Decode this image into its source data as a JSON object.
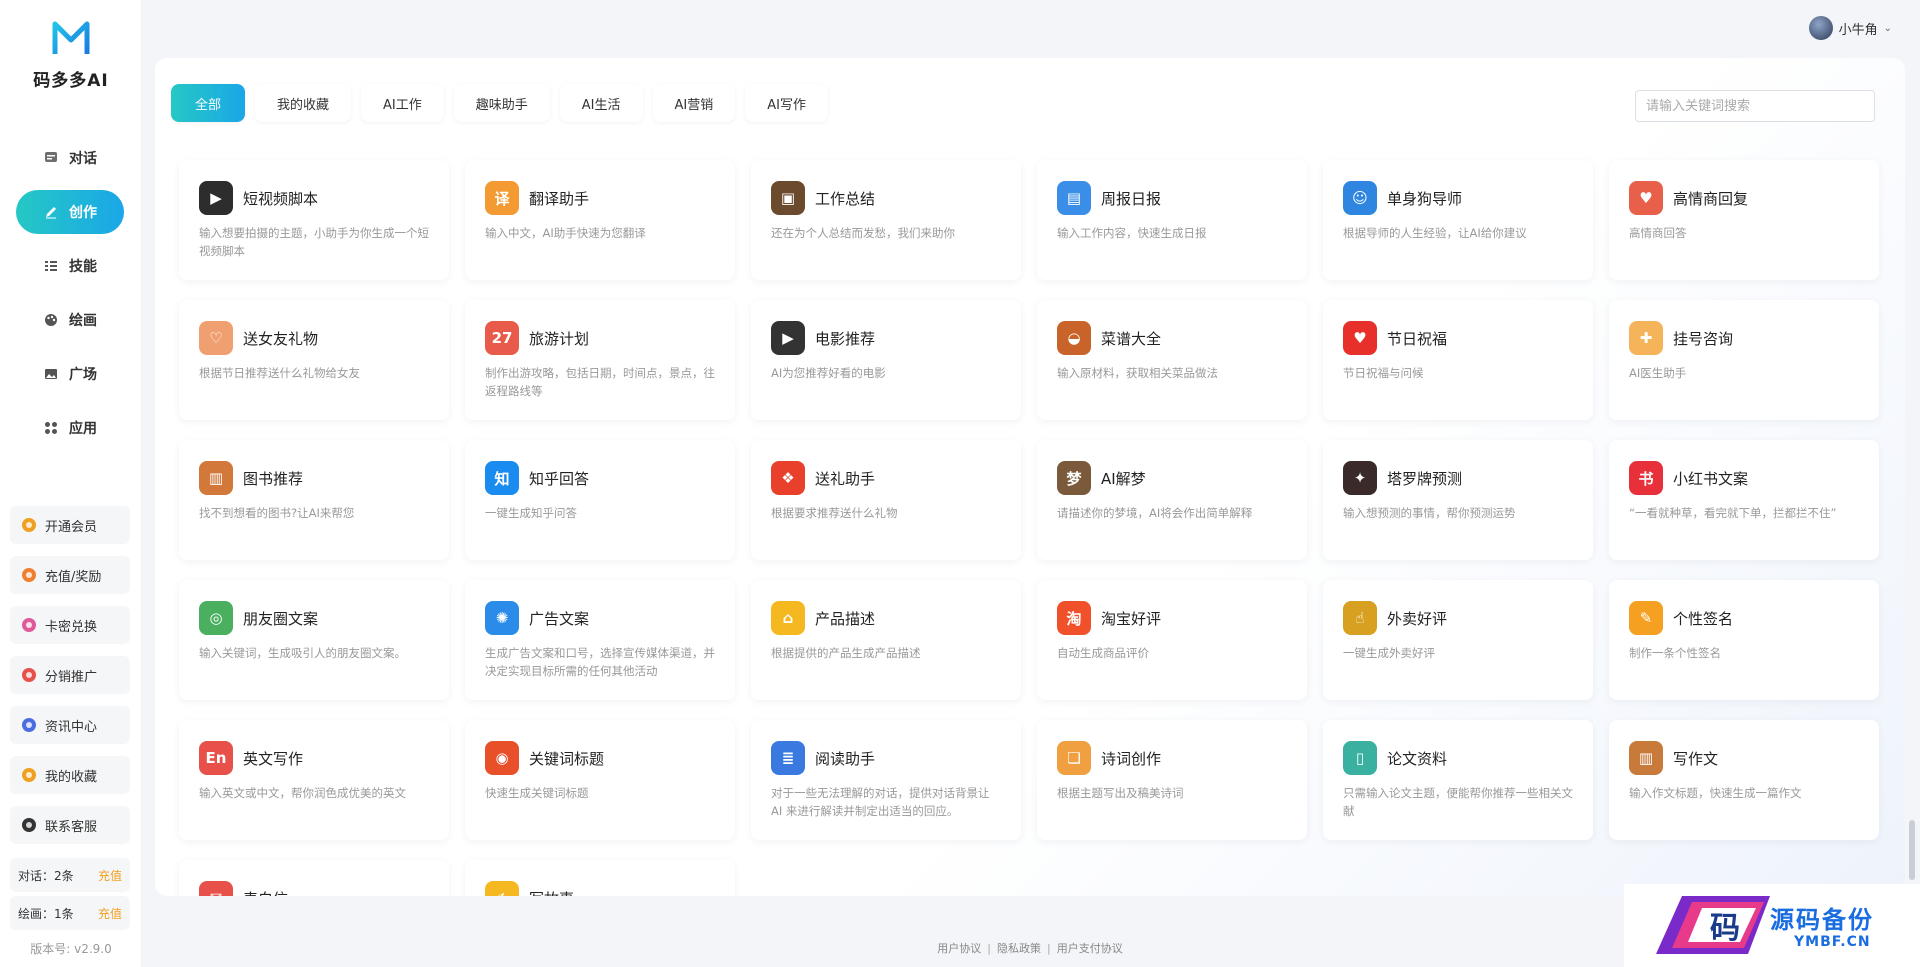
{
  "app": {
    "name": "码多多AI",
    "version": "版本号: v2.9.0"
  },
  "nav": [
    {
      "label": "对话",
      "icon": "chat-icon",
      "active": false
    },
    {
      "label": "创作",
      "icon": "pen-icon",
      "active": true
    },
    {
      "label": "技能",
      "icon": "list-icon",
      "active": false
    },
    {
      "label": "绘画",
      "icon": "palette-icon",
      "active": false
    },
    {
      "label": "广场",
      "icon": "picture-icon",
      "active": false
    },
    {
      "label": "应用",
      "icon": "apps-icon",
      "active": false
    }
  ],
  "sidebar_buttons": [
    {
      "label": "开通会员",
      "icon": "crown-icon",
      "color": "#f0a020"
    },
    {
      "label": "充值/奖励",
      "icon": "coin-icon",
      "color": "#f08030"
    },
    {
      "label": "卡密兑换",
      "icon": "card-icon",
      "color": "#e05a9a"
    },
    {
      "label": "分销推广",
      "icon": "share-icon",
      "color": "#e8504a"
    },
    {
      "label": "资讯中心",
      "icon": "news-icon",
      "color": "#4a6ee0"
    },
    {
      "label": "我的收藏",
      "icon": "star-icon",
      "color": "#f0a020"
    },
    {
      "label": "联系客服",
      "icon": "headset-icon",
      "color": "#333333"
    }
  ],
  "quota": [
    {
      "label": "对话：2条",
      "action": "充值"
    },
    {
      "label": "绘画：1条",
      "action": "充值"
    }
  ],
  "user": {
    "name": "小牛角"
  },
  "tabs": [
    "全部",
    "我的收藏",
    "AI工作",
    "趣味助手",
    "AI生活",
    "AI营销",
    "AI写作"
  ],
  "search": {
    "placeholder": "请输入关键词搜索"
  },
  "cards": [
    {
      "title": "短视频脚本",
      "desc": "输入想要拍摄的主题，小助手为你生成一个短视频脚本",
      "icon": "clapperboard-icon",
      "glyph": "▶",
      "color": "#2d2d2d"
    },
    {
      "title": "翻译助手",
      "desc": "输入中文，AI助手快速为您翻译",
      "icon": "translate-icon",
      "glyph": "译",
      "color": "#f39a32"
    },
    {
      "title": "工作总结",
      "desc": "还在为个人总结而发愁，我们来助你",
      "icon": "briefcase-icon",
      "glyph": "▣",
      "color": "#6b4a2e"
    },
    {
      "title": "周报日报",
      "desc": "输入工作内容，快速生成日报",
      "icon": "report-icon",
      "glyph": "▤",
      "color": "#3a8ee8"
    },
    {
      "title": "单身狗导师",
      "desc": "根据导师的人生经验，让AI给你建议",
      "icon": "id-card-icon",
      "glyph": "☺",
      "color": "#2f86e0"
    },
    {
      "title": "高情商回复",
      "desc": "高情商回答",
      "icon": "heart-chat-icon",
      "glyph": "♥",
      "color": "#e8604a"
    },
    {
      "title": "送女友礼物",
      "desc": "根据节日推荐送什么礼物给女友",
      "icon": "couple-icon",
      "glyph": "♡",
      "color": "#f0a070"
    },
    {
      "title": "旅游计划",
      "desc": "制作出游攻略，包括日期，时间点，景点，往返程路线等",
      "icon": "calendar-icon",
      "glyph": "27",
      "color": "#e85a4a"
    },
    {
      "title": "电影推荐",
      "desc": "AI为您推荐好看的电影",
      "icon": "film-icon",
      "glyph": "▶",
      "color": "#333333"
    },
    {
      "title": "菜谱大全",
      "desc": "输入原材料，获取相关菜品做法",
      "icon": "bowl-icon",
      "glyph": "◒",
      "color": "#c8642a"
    },
    {
      "title": "节日祝福",
      "desc": "节日祝福与问候",
      "icon": "heart-icon",
      "glyph": "♥",
      "color": "#e8302a"
    },
    {
      "title": "挂号咨询",
      "desc": "AI医生助手",
      "icon": "nurse-icon",
      "glyph": "✚",
      "color": "#f5b45a"
    },
    {
      "title": "图书推荐",
      "desc": "找不到想看的图书?让AI来帮您",
      "icon": "book-icon",
      "glyph": "▥",
      "color": "#d2783a"
    },
    {
      "title": "知乎回答",
      "desc": "一键生成知乎问答",
      "icon": "zhihu-icon",
      "glyph": "知",
      "color": "#1a8cf0"
    },
    {
      "title": "送礼助手",
      "desc": "根据要求推荐送什么礼物",
      "icon": "gift-icon",
      "glyph": "❖",
      "color": "#e8402a"
    },
    {
      "title": "AI解梦",
      "desc": "请描述你的梦境，AI将会作出简单解释",
      "icon": "dream-icon",
      "glyph": "梦",
      "color": "#7a5a3a"
    },
    {
      "title": "塔罗牌预测",
      "desc": "输入想预测的事情，帮你预测运势",
      "icon": "tarot-icon",
      "glyph": "✦",
      "color": "#3a2a2a"
    },
    {
      "title": "小红书文案",
      "desc": "“一看就种草，看完就下单，拦都拦不住”",
      "icon": "xiaohongshu-icon",
      "glyph": "书",
      "color": "#e8303a"
    },
    {
      "title": "朋友圈文案",
      "desc": "输入关键词，生成吸引人的朋友圈文案。",
      "icon": "aperture-icon",
      "glyph": "◎",
      "color": "#4ab060"
    },
    {
      "title": "广告文案",
      "desc": "生成广告文案和口号，选择宣传媒体渠道，并决定实现目标所需的任何其他活动",
      "icon": "bulb-icon",
      "glyph": "✺",
      "color": "#2a8ce8"
    },
    {
      "title": "产品描述",
      "desc": "根据提供的产品生成产品描述",
      "icon": "bag-icon",
      "glyph": "⌂",
      "color": "#f5b820"
    },
    {
      "title": "淘宝好评",
      "desc": "自动生成商品评价",
      "icon": "taobao-icon",
      "glyph": "淘",
      "color": "#f0502a"
    },
    {
      "title": "外卖好评",
      "desc": "一键生成外卖好评",
      "icon": "thumbs-up-icon",
      "glyph": "☝",
      "color": "#d8a020"
    },
    {
      "title": "个性签名",
      "desc": "制作一条个性签名",
      "icon": "pencil-icon",
      "glyph": "✎",
      "color": "#f5a020"
    },
    {
      "title": "英文写作",
      "desc": "输入英文或中文，帮你润色成优美的英文",
      "icon": "english-icon",
      "glyph": "En",
      "color": "#e8504a"
    },
    {
      "title": "关键词标题",
      "desc": "快速生成关键词标题",
      "icon": "target-icon",
      "glyph": "◉",
      "color": "#e8502a"
    },
    {
      "title": "阅读助手",
      "desc": "对于一些无法理解的对话，提供对话背景让 AI 来进行解读并制定出适当的回应。",
      "icon": "books-icon",
      "glyph": "≣",
      "color": "#3a7ae0"
    },
    {
      "title": "诗词创作",
      "desc": "根据主题写出及稿美诗词",
      "icon": "open-book-icon",
      "glyph": "❏",
      "color": "#f0a040"
    },
    {
      "title": "论文资料",
      "desc": "只需输入论文主题，便能帮你推荐一些相关文献",
      "icon": "binders-icon",
      "glyph": "▯",
      "color": "#3ab0a0"
    },
    {
      "title": "写作文",
      "desc": "输入作文标题，快速生成一篇作文",
      "icon": "notebook-icon",
      "glyph": "▥",
      "color": "#c87a3a"
    },
    {
      "title": "表白信",
      "desc": "",
      "icon": "love-letter-icon",
      "glyph": "✉",
      "color": "#e8504a"
    },
    {
      "title": "写故事",
      "desc": "",
      "icon": "story-icon",
      "glyph": "✍",
      "color": "#f5b820"
    }
  ],
  "footer": [
    "用户协议",
    "隐私政策",
    "用户支付协议"
  ],
  "watermark": {
    "text": "源码备份",
    "sub": "YMBF.CN",
    "glyph": "码"
  }
}
